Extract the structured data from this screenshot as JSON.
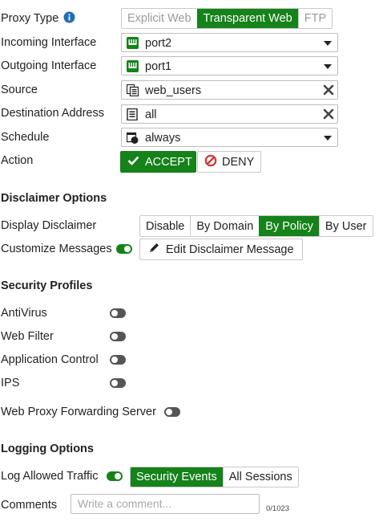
{
  "proxy_type": {
    "label": "Proxy Type",
    "options": [
      "Explicit Web",
      "Transparent Web",
      "FTP"
    ],
    "selected": "Transparent Web"
  },
  "incoming_interface": {
    "label": "Incoming Interface",
    "value": "port2"
  },
  "outgoing_interface": {
    "label": "Outgoing Interface",
    "value": "port1"
  },
  "source": {
    "label": "Source",
    "value": "web_users"
  },
  "destination": {
    "label": "Destination Address",
    "value": "all"
  },
  "schedule": {
    "label": "Schedule",
    "value": "always"
  },
  "action": {
    "label": "Action",
    "accept_label": "ACCEPT",
    "deny_label": "DENY",
    "selected": "ACCEPT"
  },
  "disclaimer": {
    "heading": "Disclaimer Options",
    "display_label": "Display Disclaimer",
    "options": [
      "Disable",
      "By Domain",
      "By Policy",
      "By User"
    ],
    "selected": "By Policy",
    "customize_label": "Customize Messages",
    "customize_enabled": true,
    "edit_button_label": "Edit Disclaimer Message"
  },
  "security_profiles": {
    "heading": "Security Profiles",
    "items": [
      {
        "label": "AntiVirus",
        "enabled": false
      },
      {
        "label": "Web Filter",
        "enabled": false
      },
      {
        "label": "Application Control",
        "enabled": false
      },
      {
        "label": "IPS",
        "enabled": false
      }
    ],
    "forwarding_label": "Web Proxy Forwarding Server",
    "forwarding_enabled": false
  },
  "logging": {
    "heading": "Logging Options",
    "log_allowed_label": "Log Allowed Traffic",
    "log_allowed_enabled": true,
    "options": [
      "Security Events",
      "All Sessions"
    ],
    "selected": "Security Events"
  },
  "comments": {
    "label": "Comments",
    "placeholder": "Write a comment...",
    "value": "",
    "counter": "0/1023"
  },
  "colors": {
    "accent": "#15821a",
    "info": "#1f6fb5",
    "deny": "#d0312d"
  },
  "icons": {
    "info": "info-icon",
    "interface": "port-icon",
    "address": "address-group-icon",
    "schedule": "schedule-icon",
    "remove": "remove-icon",
    "check": "check-icon",
    "deny": "deny-icon",
    "edit": "pencil-icon"
  }
}
